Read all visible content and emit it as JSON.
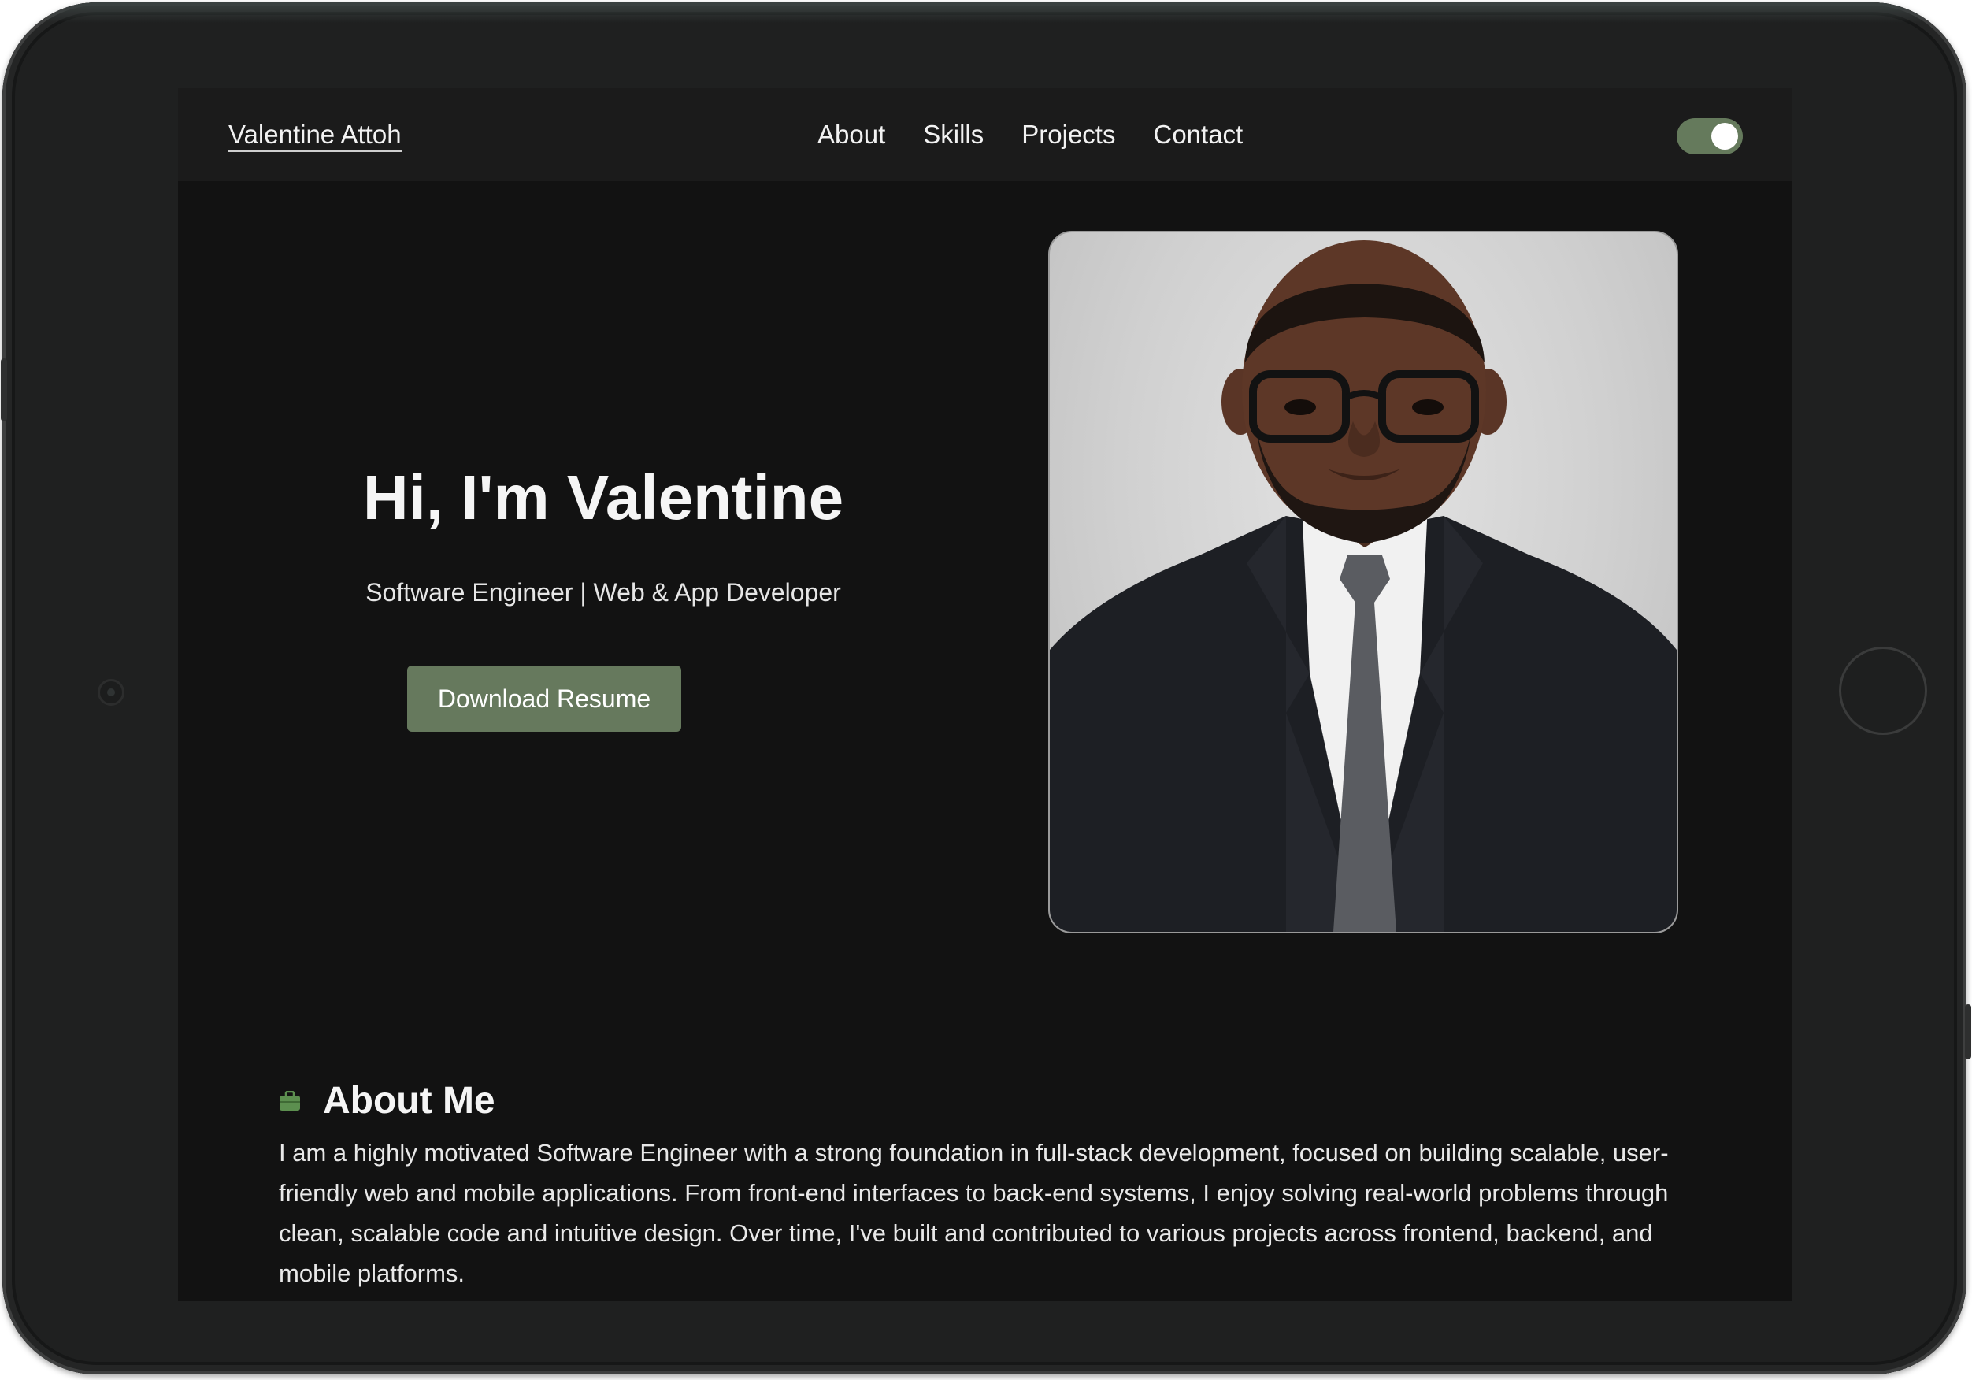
{
  "navbar": {
    "brand": "Valentine Attoh",
    "links": [
      "About",
      "Skills",
      "Projects",
      "Contact"
    ],
    "theme_toggle_on": true
  },
  "hero": {
    "title": "Hi, I'm Valentine",
    "subtitle": "Software Engineer | Web & App Developer",
    "button_label": "Download Resume",
    "portrait_icon": "profile-portrait"
  },
  "about": {
    "icon": "briefcase-icon",
    "title": "About Me",
    "text": "I am a highly motivated Software Engineer with a strong foundation in full-stack development, focused on building scalable, user-friendly web and mobile applications. From front-end interfaces to back-end systems, I enjoy solving real-world problems through clean, scalable code and intuitive design. Over time, I've built and contributed to various projects across frontend, backend, and mobile platforms."
  },
  "colors": {
    "accent": "#66795d",
    "background": "#121212",
    "navbar": "#1b1b1b",
    "text": "#f5f5f5"
  }
}
